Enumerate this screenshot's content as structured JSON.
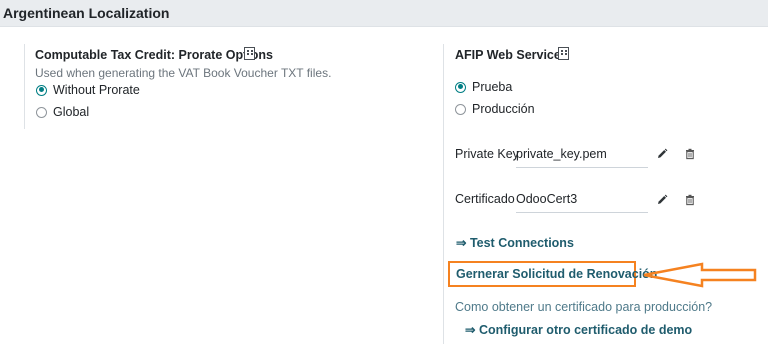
{
  "header": {
    "title": "Argentinean Localization"
  },
  "tax_credit": {
    "title": "Computable Tax Credit: Prorate Options",
    "description": "Used when generating the VAT Book Voucher TXT files.",
    "options": [
      {
        "label": "Without Prorate",
        "selected": true
      },
      {
        "label": "Global",
        "selected": false
      }
    ]
  },
  "afip": {
    "title": "AFIP Web Services",
    "environments": [
      {
        "label": "Prueba",
        "selected": true
      },
      {
        "label": "Producción",
        "selected": false
      }
    ],
    "private_key": {
      "label": "Private Key",
      "value": "private_key.pem"
    },
    "certificate": {
      "label": "Certificado",
      "value": "OdooCert3"
    },
    "test_connections": "⇒ Test Connections",
    "renewal_request": "Gernerar Solicitud de Renovación",
    "production_question": "Como obtener un certificado para producción?",
    "demo_certificate": "⇒ Configurar otro certificado de demo"
  },
  "colors": {
    "accent": "#017e84",
    "annotation": "#f58220",
    "link": "#1f5c6d"
  },
  "icons": [
    "building-icon",
    "pencil-icon",
    "trash-icon",
    "arrow-annotation-icon"
  ]
}
